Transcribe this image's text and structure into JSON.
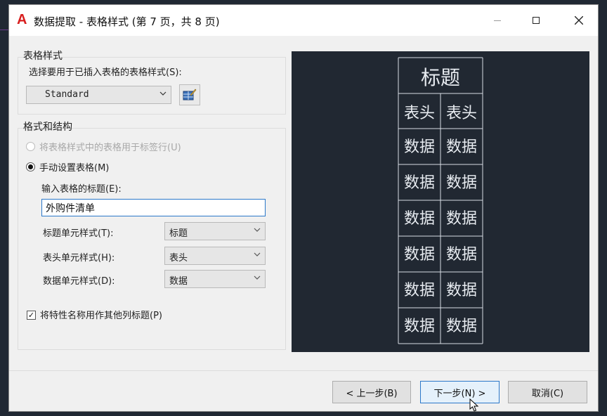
{
  "window": {
    "title": "数据提取 - 表格样式 (第 7 页，共 8 页)",
    "app_icon": "autocad-a-icon",
    "minimize": "—",
    "maximize": "☐",
    "close": "✕"
  },
  "table_style_group": {
    "label": "表格样式",
    "prompt": "选择要用于已插入表格的表格样式(S):",
    "style_value": "Standard"
  },
  "format_group": {
    "label": "格式和结构",
    "radio_use_table_style": "将表格样式中的表格用于标签行(U)",
    "radio_manual": "手动设置表格(M)",
    "manual_selected": true,
    "title_prompt": "输入表格的标题(E):",
    "title_value": "外购件清单",
    "title_cell_label": "标题单元样式(T):",
    "title_cell_value": "标题",
    "header_cell_label": "表头单元样式(H):",
    "header_cell_value": "表头",
    "data_cell_label": "数据单元样式(D):",
    "data_cell_value": "数据",
    "checkbox_label": "将特性名称用作其他列标题(P)",
    "checkbox_checked": true
  },
  "preview": {
    "title": "标题",
    "headers": [
      "表头",
      "表头"
    ],
    "rows": [
      [
        "数据",
        "数据"
      ],
      [
        "数据",
        "数据"
      ],
      [
        "数据",
        "数据"
      ],
      [
        "数据",
        "数据"
      ],
      [
        "数据",
        "数据"
      ],
      [
        "数据",
        "数据"
      ]
    ]
  },
  "buttons": {
    "back": "< 上一步(B)",
    "next": "下一步(N) >",
    "cancel": "取消(C)"
  },
  "colors": {
    "preview_bg": "#212832",
    "accent": "#2b78c9",
    "app_icon": "#d81e1e"
  }
}
